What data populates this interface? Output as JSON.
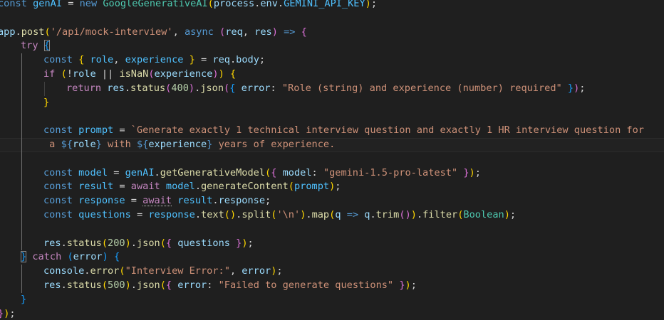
{
  "lines": [
    {
      "n": "l1",
      "indent": 0,
      "tokens": [
        [
          "const",
          "kw"
        ],
        [
          " ",
          "pun"
        ],
        [
          "genAI",
          "con"
        ],
        [
          " = ",
          "op"
        ],
        [
          "new",
          "kw"
        ],
        [
          " ",
          "pun"
        ],
        [
          "GoogleGenerativeAI",
          "cls"
        ],
        [
          "(",
          "b1"
        ],
        [
          "process",
          "var"
        ],
        [
          ".",
          "pun"
        ],
        [
          "env",
          "var"
        ],
        [
          ".",
          "pun"
        ],
        [
          "GEMINI_API_KEY",
          "con"
        ],
        [
          ")",
          "b1"
        ],
        [
          ";",
          "pun"
        ]
      ]
    },
    {
      "n": "l2",
      "indent": 0,
      "tokens": []
    },
    {
      "n": "l3",
      "indent": 0,
      "tokens": [
        [
          "app",
          "var"
        ],
        [
          ".",
          "pun"
        ],
        [
          "post",
          "fn"
        ],
        [
          "(",
          "b1"
        ],
        [
          "'/api/mock-interview'",
          "str"
        ],
        [
          ", ",
          "pun"
        ],
        [
          "async",
          "kw"
        ],
        [
          " ",
          "pun"
        ],
        [
          "(",
          "b2"
        ],
        [
          "req",
          "var"
        ],
        [
          ", ",
          "pun"
        ],
        [
          "res",
          "var"
        ],
        [
          ")",
          "b2"
        ],
        [
          " ",
          "pun"
        ],
        [
          "=>",
          "kw"
        ],
        [
          " ",
          "pun"
        ],
        [
          "{",
          "b2"
        ]
      ]
    },
    {
      "n": "l4",
      "indent": 1,
      "tokens": [
        [
          "try",
          "ctl"
        ],
        [
          " ",
          "pun"
        ],
        [
          "{",
          "b3",
          "mb"
        ]
      ]
    },
    {
      "n": "l5",
      "indent": 2,
      "tokens": [
        [
          "const",
          "kw"
        ],
        [
          " ",
          "pun"
        ],
        [
          "{",
          "b1"
        ],
        [
          " ",
          "pun"
        ],
        [
          "role",
          "con"
        ],
        [
          ", ",
          "pun"
        ],
        [
          "experience",
          "con"
        ],
        [
          " ",
          "pun"
        ],
        [
          "}",
          "b1"
        ],
        [
          " = ",
          "op"
        ],
        [
          "req",
          "var"
        ],
        [
          ".",
          "pun"
        ],
        [
          "body",
          "var"
        ],
        [
          ";",
          "pun"
        ]
      ]
    },
    {
      "n": "l6",
      "indent": 2,
      "tokens": [
        [
          "if",
          "ctl"
        ],
        [
          " ",
          "pun"
        ],
        [
          "(",
          "b1"
        ],
        [
          "!",
          "op"
        ],
        [
          "role",
          "var"
        ],
        [
          " || ",
          "op"
        ],
        [
          "isNaN",
          "fn"
        ],
        [
          "(",
          "b2"
        ],
        [
          "experience",
          "var"
        ],
        [
          ")",
          "b2"
        ],
        [
          ")",
          "b1"
        ],
        [
          " ",
          "pun"
        ],
        [
          "{",
          "b1"
        ]
      ]
    },
    {
      "n": "l7",
      "indent": 3,
      "tokens": [
        [
          "return",
          "ctl"
        ],
        [
          " ",
          "pun"
        ],
        [
          "res",
          "var"
        ],
        [
          ".",
          "pun"
        ],
        [
          "status",
          "fn"
        ],
        [
          "(",
          "b2"
        ],
        [
          "400",
          "num"
        ],
        [
          ")",
          "b2"
        ],
        [
          ".",
          "pun"
        ],
        [
          "json",
          "fn"
        ],
        [
          "(",
          "b2"
        ],
        [
          "{",
          "b3"
        ],
        [
          " ",
          "pun"
        ],
        [
          "error",
          "var"
        ],
        [
          ": ",
          "pun"
        ],
        [
          "\"Role (string) and experience (number) required\"",
          "str"
        ],
        [
          " ",
          "pun"
        ],
        [
          "}",
          "b3"
        ],
        [
          ")",
          "b2"
        ],
        [
          ";",
          "pun"
        ]
      ]
    },
    {
      "n": "l8",
      "indent": 2,
      "tokens": [
        [
          "}",
          "b1"
        ]
      ]
    },
    {
      "n": "l9",
      "indent": 2,
      "tokens": []
    },
    {
      "n": "l10",
      "indent": 2,
      "tokens": [
        [
          "const",
          "kw"
        ],
        [
          " ",
          "pun"
        ],
        [
          "prompt",
          "con"
        ],
        [
          " = ",
          "op"
        ],
        [
          "`Generate exactly 1 technical interview question and exactly 1 HR interview question for",
          "str"
        ]
      ]
    },
    {
      "n": "l11",
      "indent": 2,
      "current": true,
      "tokens": [
        [
          " a ",
          "str"
        ],
        [
          "${",
          "kw"
        ],
        [
          "role",
          "var"
        ],
        [
          "}",
          "kw"
        ],
        [
          " with ",
          "str"
        ],
        [
          "${",
          "kw"
        ],
        [
          "experience",
          "var"
        ],
        [
          "}",
          "kw"
        ],
        [
          " years of experience.",
          "str"
        ]
      ]
    },
    {
      "n": "l12",
      "indent": 2,
      "tokens": []
    },
    {
      "n": "l13",
      "indent": 2,
      "tokens": [
        [
          "const",
          "kw"
        ],
        [
          " ",
          "pun"
        ],
        [
          "model",
          "con"
        ],
        [
          " = ",
          "op"
        ],
        [
          "genAI",
          "con"
        ],
        [
          ".",
          "pun"
        ],
        [
          "getGenerativeModel",
          "fn"
        ],
        [
          "(",
          "b1"
        ],
        [
          "{",
          "b2"
        ],
        [
          " ",
          "pun"
        ],
        [
          "model",
          "var"
        ],
        [
          ": ",
          "pun"
        ],
        [
          "\"gemini-1.5-pro-latest\"",
          "str"
        ],
        [
          " ",
          "pun"
        ],
        [
          "}",
          "b2"
        ],
        [
          ")",
          "b1"
        ],
        [
          ";",
          "pun"
        ]
      ]
    },
    {
      "n": "l14",
      "indent": 2,
      "tokens": [
        [
          "const",
          "kw"
        ],
        [
          " ",
          "pun"
        ],
        [
          "result",
          "con"
        ],
        [
          " = ",
          "op"
        ],
        [
          "await",
          "ctl"
        ],
        [
          " ",
          "pun"
        ],
        [
          "model",
          "con"
        ],
        [
          ".",
          "pun"
        ],
        [
          "generateContent",
          "fn"
        ],
        [
          "(",
          "b1"
        ],
        [
          "prompt",
          "con"
        ],
        [
          ")",
          "b1"
        ],
        [
          ";",
          "pun"
        ]
      ]
    },
    {
      "n": "l15",
      "indent": 2,
      "tokens": [
        [
          "const",
          "kw"
        ],
        [
          " ",
          "pun"
        ],
        [
          "response",
          "con"
        ],
        [
          " = ",
          "op"
        ],
        [
          "await",
          "ctl",
          "dot"
        ],
        [
          " ",
          "pun"
        ],
        [
          "result",
          "con"
        ],
        [
          ".",
          "pun"
        ],
        [
          "response",
          "var"
        ],
        [
          ";",
          "pun"
        ]
      ]
    },
    {
      "n": "l16",
      "indent": 2,
      "tokens": [
        [
          "const",
          "kw"
        ],
        [
          " ",
          "pun"
        ],
        [
          "questions",
          "con"
        ],
        [
          " = ",
          "op"
        ],
        [
          "response",
          "con"
        ],
        [
          ".",
          "pun"
        ],
        [
          "text",
          "fn"
        ],
        [
          "(",
          "b1"
        ],
        [
          ")",
          "b1"
        ],
        [
          ".",
          "pun"
        ],
        [
          "split",
          "fn"
        ],
        [
          "(",
          "b1"
        ],
        [
          "'\\n'",
          "str"
        ],
        [
          ")",
          "b1"
        ],
        [
          ".",
          "pun"
        ],
        [
          "map",
          "fn"
        ],
        [
          "(",
          "b1"
        ],
        [
          "q",
          "var"
        ],
        [
          " ",
          "pun"
        ],
        [
          "=>",
          "kw"
        ],
        [
          " ",
          "pun"
        ],
        [
          "q",
          "var"
        ],
        [
          ".",
          "pun"
        ],
        [
          "trim",
          "fn"
        ],
        [
          "(",
          "b2"
        ],
        [
          ")",
          "b2"
        ],
        [
          ")",
          "b1"
        ],
        [
          ".",
          "pun"
        ],
        [
          "filter",
          "fn"
        ],
        [
          "(",
          "b1"
        ],
        [
          "Boolean",
          "cls"
        ],
        [
          ")",
          "b1"
        ],
        [
          ";",
          "pun"
        ]
      ]
    },
    {
      "n": "l17",
      "indent": 2,
      "tokens": []
    },
    {
      "n": "l18",
      "indent": 2,
      "tokens": [
        [
          "res",
          "var"
        ],
        [
          ".",
          "pun"
        ],
        [
          "status",
          "fn"
        ],
        [
          "(",
          "b1"
        ],
        [
          "200",
          "num"
        ],
        [
          ")",
          "b1"
        ],
        [
          ".",
          "pun"
        ],
        [
          "json",
          "fn"
        ],
        [
          "(",
          "b1"
        ],
        [
          "{",
          "b2"
        ],
        [
          " ",
          "pun"
        ],
        [
          "questions",
          "var"
        ],
        [
          " ",
          "pun"
        ],
        [
          "}",
          "b2"
        ],
        [
          ")",
          "b1"
        ],
        [
          ";",
          "pun"
        ]
      ]
    },
    {
      "n": "l19",
      "indent": 1,
      "tokens": [
        [
          "}",
          "b3",
          "mb"
        ],
        [
          " ",
          "pun"
        ],
        [
          "catch",
          "ctl"
        ],
        [
          " ",
          "pun"
        ],
        [
          "(",
          "b3"
        ],
        [
          "error",
          "var"
        ],
        [
          ")",
          "b3"
        ],
        [
          " ",
          "pun"
        ],
        [
          "{",
          "b3"
        ]
      ]
    },
    {
      "n": "l20",
      "indent": 2,
      "tokens": [
        [
          "console",
          "var"
        ],
        [
          ".",
          "pun"
        ],
        [
          "error",
          "fn"
        ],
        [
          "(",
          "b1"
        ],
        [
          "\"Interview Error:\"",
          "str"
        ],
        [
          ", ",
          "pun"
        ],
        [
          "error",
          "var"
        ],
        [
          ")",
          "b1"
        ],
        [
          ";",
          "pun"
        ]
      ]
    },
    {
      "n": "l21",
      "indent": 2,
      "tokens": [
        [
          "res",
          "var"
        ],
        [
          ".",
          "pun"
        ],
        [
          "status",
          "fn"
        ],
        [
          "(",
          "b1"
        ],
        [
          "500",
          "num"
        ],
        [
          ")",
          "b1"
        ],
        [
          ".",
          "pun"
        ],
        [
          "json",
          "fn"
        ],
        [
          "(",
          "b1"
        ],
        [
          "{",
          "b2"
        ],
        [
          " ",
          "pun"
        ],
        [
          "error",
          "var"
        ],
        [
          ": ",
          "pun"
        ],
        [
          "\"Failed to generate questions\"",
          "str"
        ],
        [
          " ",
          "pun"
        ],
        [
          "}",
          "b2"
        ],
        [
          ")",
          "b1"
        ],
        [
          ";",
          "pun"
        ]
      ]
    },
    {
      "n": "l22",
      "indent": 1,
      "tokens": [
        [
          "}",
          "b3"
        ]
      ]
    },
    {
      "n": "l23",
      "indent": 0,
      "tokens": [
        [
          "}",
          "b2"
        ],
        [
          ")",
          "b1"
        ],
        [
          ";",
          "pun"
        ]
      ]
    }
  ]
}
